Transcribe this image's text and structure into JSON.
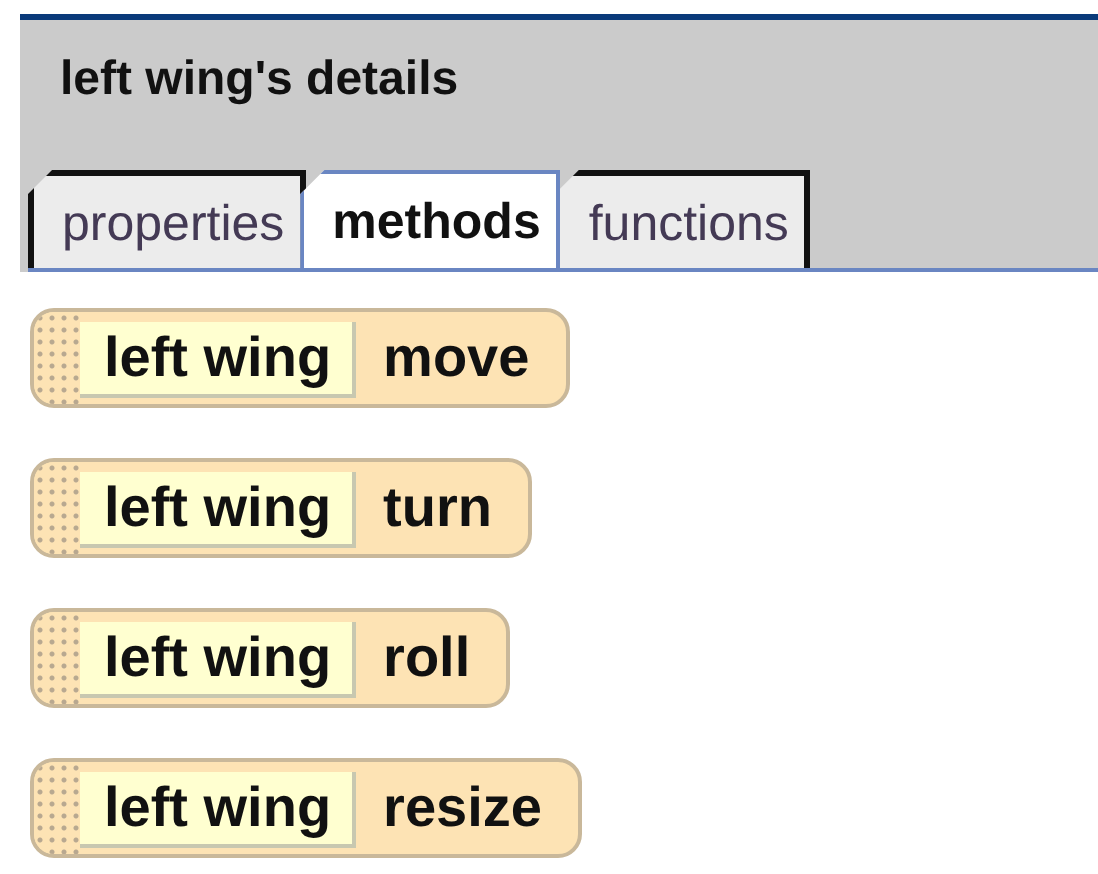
{
  "panel": {
    "title": "left wing's details"
  },
  "tabs": [
    {
      "label": "properties",
      "selected": false
    },
    {
      "label": "methods",
      "selected": true
    },
    {
      "label": "functions",
      "selected": false
    }
  ],
  "methods": [
    {
      "object": "left wing",
      "method": "move"
    },
    {
      "object": "left wing",
      "method": "turn"
    },
    {
      "object": "left wing",
      "method": "roll"
    },
    {
      "object": "left wing",
      "method": "resize"
    }
  ]
}
